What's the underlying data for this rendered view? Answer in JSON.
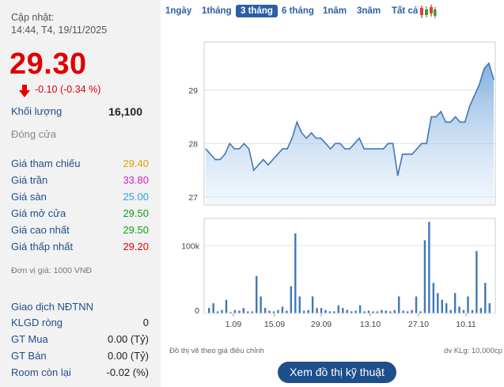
{
  "header": {
    "updated_label": "Cập nhật:",
    "updated_time": "14:44, T4, 19/11/2025",
    "price": "29.30",
    "change": "-0.10 (-0.34 %)"
  },
  "stats": [
    {
      "label": "Khối lượng",
      "value": "16,100"
    },
    {
      "label": "Đóng cửa",
      "value": ""
    }
  ],
  "prices": [
    {
      "label": "Giá tham chiếu",
      "value": "29.40",
      "color": "#e0a000"
    },
    {
      "label": "Giá trần",
      "value": "33.80",
      "color": "#d21ec8"
    },
    {
      "label": "Giá sàn",
      "value": "25.00",
      "color": "#2fa0e0"
    },
    {
      "label": "Giá mở cửa",
      "value": "29.50",
      "color": "#14a014"
    },
    {
      "label": "Giá cao nhất",
      "value": "29.50",
      "color": "#14a014"
    },
    {
      "label": "Giá thấp nhất",
      "value": "29.20",
      "color": "#e00000"
    }
  ],
  "price_unit": "Đơn vị giá: 1000 VNĐ",
  "foreign": {
    "title": "Giao dịch NĐTNN",
    "rows": [
      {
        "label": "KLGD ròng",
        "value": "0"
      },
      {
        "label": "GT Mua",
        "value": "0.00 (Tỷ)"
      },
      {
        "label": "GT Bán",
        "value": "0.00 (Tỷ)"
      },
      {
        "label": "Room còn lại",
        "value": "-0.02 (%)"
      }
    ]
  },
  "tabs": [
    "1ngày",
    "1tháng",
    "3 tháng",
    "6 tháng",
    "1năm",
    "3năm",
    "Tất cả"
  ],
  "active_tab": "3 tháng",
  "chart_note": "Đồ thị vẽ theo giá điều chỉnh",
  "chart_unit": "dv KLg: 10,000cp",
  "tech_button": "Xem đồ thị kỹ thuật",
  "chart_data": [
    {
      "type": "area",
      "yticks": [
        27,
        28,
        29
      ],
      "ylim": [
        26.85,
        29.9
      ],
      "grid": true,
      "values": [
        27.9,
        27.8,
        27.7,
        27.7,
        27.8,
        28.0,
        27.9,
        27.9,
        28.0,
        27.9,
        27.5,
        27.6,
        27.7,
        27.6,
        27.7,
        27.8,
        27.9,
        27.9,
        28.1,
        28.4,
        28.2,
        28.1,
        28.2,
        28.1,
        28.1,
        28.0,
        27.9,
        28.0,
        28.0,
        27.9,
        27.9,
        28.0,
        28.1,
        27.9,
        27.9,
        27.9,
        27.9,
        27.9,
        28.0,
        28.0,
        27.4,
        27.8,
        27.8,
        27.8,
        27.9,
        28.0,
        28.0,
        28.5,
        28.5,
        28.6,
        28.4,
        28.4,
        28.5,
        28.4,
        28.4,
        28.7,
        28.9,
        29.1,
        29.4,
        29.5,
        29.2
      ]
    },
    {
      "type": "bar",
      "yticks": [
        "0",
        "100k"
      ],
      "ylim": [
        0,
        140000
      ],
      "xticks": [
        "1.09",
        "15.09",
        "29.09",
        "13.10",
        "27.10",
        "10.11"
      ],
      "values": [
        8000,
        15000,
        3000,
        5000,
        20000,
        2000,
        5000,
        4000,
        8000,
        3000,
        3000,
        55000,
        25000,
        8000,
        4000,
        3000,
        5000,
        10000,
        4000,
        40000,
        118000,
        25000,
        4000,
        5000,
        25000,
        8000,
        8000,
        5000,
        3000,
        3000,
        12000,
        8000,
        5000,
        3000,
        4000,
        12000,
        3000,
        4000,
        3000,
        3000,
        5000,
        4000,
        3000,
        5000,
        25000,
        4000,
        3000,
        5000,
        25000,
        3000,
        108000,
        135000,
        45000,
        30000,
        20000,
        15000,
        5000,
        30000,
        10000,
        5000,
        25000,
        5000,
        92000,
        8000,
        45000,
        15000
      ]
    }
  ]
}
